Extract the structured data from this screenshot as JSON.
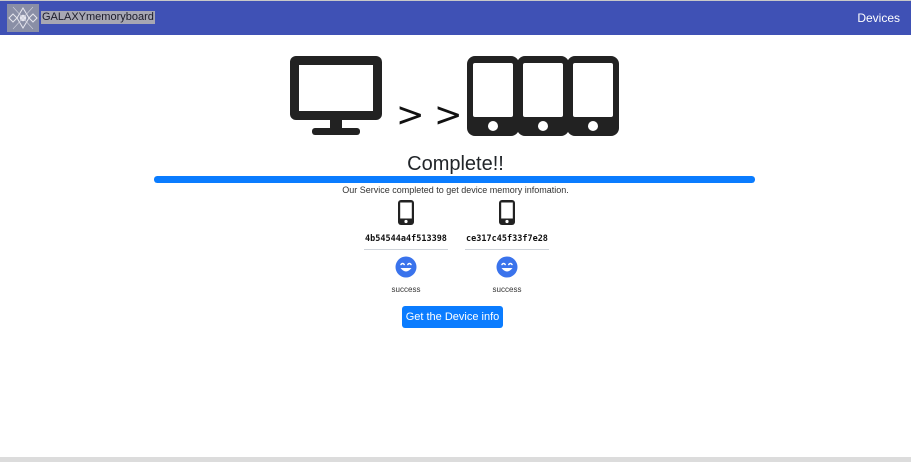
{
  "header": {
    "brand": "GALAXYmemoryboard",
    "nav_link": "Devices"
  },
  "hero": {
    "separators": [
      ">",
      ">"
    ]
  },
  "progress": {
    "title": "Complete!!",
    "percent": 100,
    "message": "Our Service completed to get device memory infomation."
  },
  "devices": [
    {
      "id": "4b54544a4f513398",
      "status": "success"
    },
    {
      "id": "ce317c45f33f7e28",
      "status": "success"
    }
  ],
  "actions": {
    "get_info": "Get the Device info"
  },
  "colors": {
    "navbar": "#3f51b5",
    "accent": "#0a7cff",
    "emoji": "#3a73ec"
  },
  "icons": [
    "logo-icon",
    "monitor-icon",
    "phone-icon",
    "smile-icon"
  ]
}
